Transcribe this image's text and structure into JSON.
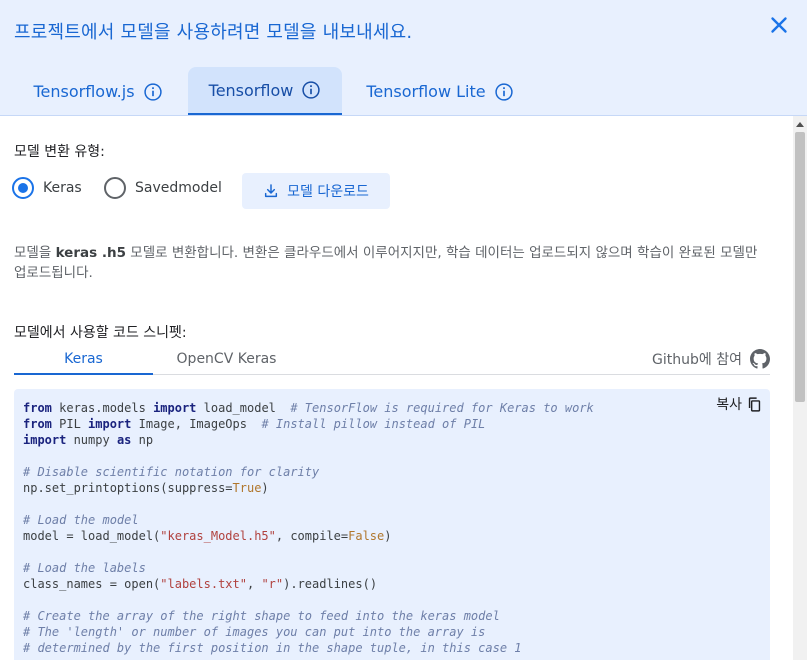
{
  "header": {
    "title": "프로젝트에서 모델을 사용하려면 모델을 내보내세요.",
    "tabs": [
      {
        "label": "Tensorflow.js"
      },
      {
        "label": "Tensorflow"
      },
      {
        "label": "Tensorflow Lite"
      }
    ],
    "active_tab": "Tensorflow"
  },
  "conversion": {
    "label": "모델 변환 유형:",
    "options": [
      {
        "label": "Keras",
        "checked": true
      },
      {
        "label": "Savedmodel",
        "checked": false
      }
    ],
    "download_label": "모델 다운로드"
  },
  "description": {
    "prefix": "모델을 ",
    "bold": "keras .h5",
    "suffix": " 모델로 변환합니다. 변환은 클라우드에서 이루어지지만, 학습 데이터는 업로드되지 않으며 학습이 완료된 모델만 업로드됩니다."
  },
  "snippet": {
    "label": "모델에서 사용할 코드 스니펫:",
    "tabs": [
      {
        "label": "Keras"
      },
      {
        "label": "OpenCV Keras"
      }
    ],
    "github_label": "Github에 참여",
    "copy_label": "복사",
    "code_lines": [
      "from keras.models import load_model  # TensorFlow is required for Keras to work",
      "from PIL import Image, ImageOps  # Install pillow instead of PIL",
      "import numpy as np",
      "",
      "# Disable scientific notation for clarity",
      "np.set_printoptions(suppress=True)",
      "",
      "# Load the model",
      "model = load_model(\"keras_Model.h5\", compile=False)",
      "",
      "# Load the labels",
      "class_names = open(\"labels.txt\", \"r\").readlines()",
      "",
      "# Create the array of the right shape to feed into the keras model",
      "# The 'length' or number of images you can put into the array is",
      "# determined by the first position in the shape tuple, in this case 1"
    ]
  },
  "colors": {
    "accent": "#1a73e8",
    "header_bg": "#e8f0fe",
    "code_bg": "#e8f0fe"
  }
}
